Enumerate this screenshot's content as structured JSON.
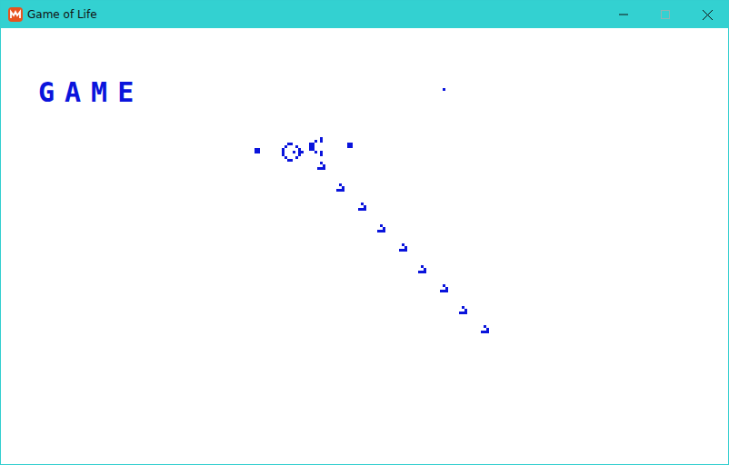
{
  "window": {
    "title": "Game of Life",
    "controls": [
      {
        "kind": "minimize",
        "disabled": false
      },
      {
        "kind": "maximize",
        "disabled": true
      },
      {
        "kind": "close",
        "disabled": false
      }
    ]
  },
  "label": "GAME",
  "board": {
    "cell_color": "#0a14dc",
    "cells": [
      [
        117,
        40
      ],
      [
        115,
        41
      ],
      [
        117,
        41
      ],
      [
        105,
        42
      ],
      [
        106,
        42
      ],
      [
        113,
        42
      ],
      [
        114,
        42
      ],
      [
        127,
        42
      ],
      [
        128,
        42
      ],
      [
        104,
        43
      ],
      [
        108,
        43
      ],
      [
        113,
        43
      ],
      [
        114,
        43
      ],
      [
        127,
        43
      ],
      [
        128,
        43
      ],
      [
        93,
        44
      ],
      [
        94,
        44
      ],
      [
        103,
        44
      ],
      [
        109,
        44
      ],
      [
        113,
        44
      ],
      [
        114,
        44
      ],
      [
        93,
        45
      ],
      [
        94,
        45
      ],
      [
        103,
        45
      ],
      [
        107,
        45
      ],
      [
        109,
        45
      ],
      [
        110,
        45
      ],
      [
        115,
        45
      ],
      [
        117,
        45
      ],
      [
        103,
        46
      ],
      [
        109,
        46
      ],
      [
        117,
        46
      ],
      [
        104,
        47
      ],
      [
        108,
        47
      ],
      [
        105,
        48
      ],
      [
        106,
        48
      ],
      [
        117,
        49
      ],
      [
        118,
        50
      ],
      [
        116,
        51
      ],
      [
        117,
        51
      ],
      [
        118,
        51
      ],
      [
        124,
        57
      ],
      [
        125,
        58
      ],
      [
        123,
        59
      ],
      [
        124,
        59
      ],
      [
        125,
        59
      ],
      [
        132,
        64
      ],
      [
        133,
        65
      ],
      [
        131,
        66
      ],
      [
        132,
        66
      ],
      [
        133,
        66
      ],
      [
        139,
        72
      ],
      [
        140,
        73
      ],
      [
        138,
        74
      ],
      [
        139,
        74
      ],
      [
        140,
        74
      ],
      [
        147,
        79
      ],
      [
        148,
        80
      ],
      [
        146,
        81
      ],
      [
        147,
        81
      ],
      [
        148,
        81
      ],
      [
        154,
        87
      ],
      [
        155,
        88
      ],
      [
        153,
        89
      ],
      [
        154,
        89
      ],
      [
        155,
        89
      ],
      [
        162,
        94
      ],
      [
        163,
        95
      ],
      [
        161,
        96
      ],
      [
        162,
        96
      ],
      [
        163,
        96
      ],
      [
        169,
        102
      ],
      [
        170,
        103
      ],
      [
        168,
        104
      ],
      [
        169,
        104
      ],
      [
        170,
        104
      ],
      [
        177,
        109
      ],
      [
        178,
        110
      ],
      [
        176,
        111
      ],
      [
        177,
        111
      ],
      [
        178,
        111
      ],
      [
        162,
        22
      ]
    ]
  }
}
